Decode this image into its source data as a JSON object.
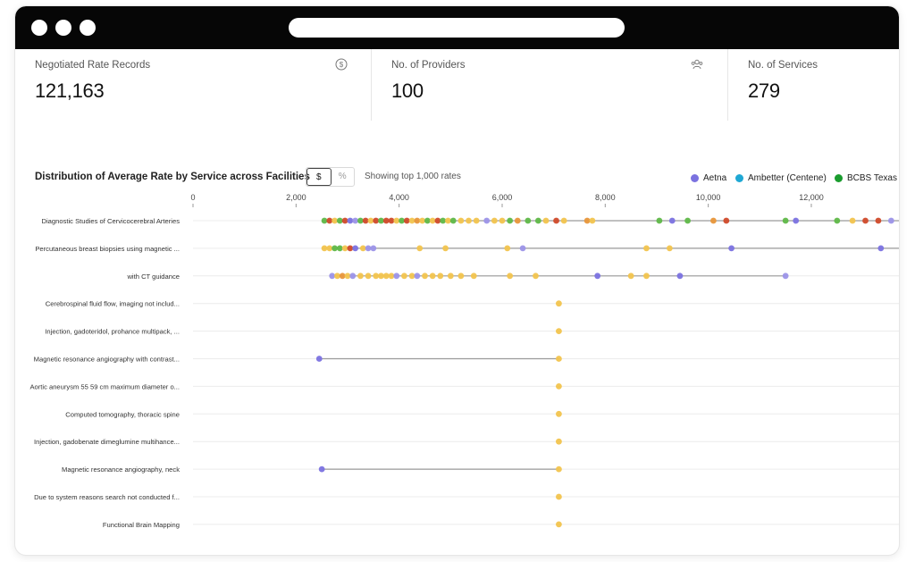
{
  "kpis": [
    {
      "label": "Negotiated Rate Records",
      "value": "121,163",
      "icon": "dollar-icon"
    },
    {
      "label": "No. of Providers",
      "value": "100",
      "icon": "users-icon"
    },
    {
      "label": "No. of Services",
      "value": "279"
    }
  ],
  "chart_header": {
    "title": "Distribution of Average Rate by Service across Facilities",
    "toggle_dollar": "$",
    "toggle_percent": "%",
    "showing": "Showing top 1,000 rates"
  },
  "legend": [
    {
      "name": "Aetna",
      "color": "#7b72e0"
    },
    {
      "name": "Ambetter (Centene)",
      "color": "#1fa8d4"
    },
    {
      "name": "BCBS Texas",
      "color": "#1a9c2e"
    }
  ],
  "colors": {
    "yellow": "#f2c44e",
    "green": "#5fb848",
    "red": "#d04a2a",
    "orange": "#e8963a",
    "purple": "#7b72e0",
    "lavender": "#9c94e8",
    "line": "#9a9a9a"
  },
  "chart_data": {
    "type": "scatter",
    "x_ticks": [
      "0",
      "2,000",
      "4,000",
      "6,000",
      "8,000",
      "10,000",
      "12,000"
    ],
    "x_tick_values": [
      0,
      2000,
      4000,
      6000,
      8000,
      10000,
      12000
    ],
    "xlim": [
      0,
      13700
    ],
    "grid": true,
    "rows": [
      {
        "label": "Diagnostic Studies of Cervicocerebral Arteries",
        "min": 2500,
        "max": 13700,
        "points": [
          {
            "x": 2550,
            "c": "green"
          },
          {
            "x": 2650,
            "c": "red"
          },
          {
            "x": 2750,
            "c": "yellow"
          },
          {
            "x": 2850,
            "c": "green"
          },
          {
            "x": 2950,
            "c": "red"
          },
          {
            "x": 3050,
            "c": "purple"
          },
          {
            "x": 3150,
            "c": "lavender"
          },
          {
            "x": 3250,
            "c": "green"
          },
          {
            "x": 3350,
            "c": "red"
          },
          {
            "x": 3450,
            "c": "yellow"
          },
          {
            "x": 3550,
            "c": "red"
          },
          {
            "x": 3650,
            "c": "green"
          },
          {
            "x": 3750,
            "c": "red"
          },
          {
            "x": 3850,
            "c": "red"
          },
          {
            "x": 3950,
            "c": "yellow"
          },
          {
            "x": 4050,
            "c": "green"
          },
          {
            "x": 4150,
            "c": "red"
          },
          {
            "x": 4250,
            "c": "yellow"
          },
          {
            "x": 4350,
            "c": "orange"
          },
          {
            "x": 4450,
            "c": "yellow"
          },
          {
            "x": 4550,
            "c": "green"
          },
          {
            "x": 4650,
            "c": "yellow"
          },
          {
            "x": 4750,
            "c": "red"
          },
          {
            "x": 4850,
            "c": "green"
          },
          {
            "x": 4950,
            "c": "yellow"
          },
          {
            "x": 5050,
            "c": "green"
          },
          {
            "x": 5200,
            "c": "yellow"
          },
          {
            "x": 5350,
            "c": "yellow"
          },
          {
            "x": 5500,
            "c": "yellow"
          },
          {
            "x": 5700,
            "c": "lavender"
          },
          {
            "x": 5850,
            "c": "yellow"
          },
          {
            "x": 6000,
            "c": "yellow"
          },
          {
            "x": 6150,
            "c": "green"
          },
          {
            "x": 6300,
            "c": "orange"
          },
          {
            "x": 6500,
            "c": "green"
          },
          {
            "x": 6700,
            "c": "green"
          },
          {
            "x": 6850,
            "c": "yellow"
          },
          {
            "x": 7050,
            "c": "red"
          },
          {
            "x": 7200,
            "c": "yellow"
          },
          {
            "x": 7650,
            "c": "orange"
          },
          {
            "x": 7750,
            "c": "yellow"
          },
          {
            "x": 9050,
            "c": "green"
          },
          {
            "x": 9300,
            "c": "purple"
          },
          {
            "x": 9600,
            "c": "green"
          },
          {
            "x": 10100,
            "c": "orange"
          },
          {
            "x": 10350,
            "c": "red"
          },
          {
            "x": 11500,
            "c": "green"
          },
          {
            "x": 11700,
            "c": "purple"
          },
          {
            "x": 12500,
            "c": "green"
          },
          {
            "x": 12800,
            "c": "yellow"
          },
          {
            "x": 13050,
            "c": "red"
          },
          {
            "x": 13300,
            "c": "red"
          },
          {
            "x": 13550,
            "c": "lavender"
          }
        ]
      },
      {
        "label": "Percutaneous breast biopsies using magnetic ...",
        "min": 2500,
        "max": 13700,
        "points": [
          {
            "x": 2550,
            "c": "yellow"
          },
          {
            "x": 2650,
            "c": "yellow"
          },
          {
            "x": 2750,
            "c": "green"
          },
          {
            "x": 2850,
            "c": "green"
          },
          {
            "x": 2950,
            "c": "yellow"
          },
          {
            "x": 3050,
            "c": "red"
          },
          {
            "x": 3150,
            "c": "purple"
          },
          {
            "x": 3300,
            "c": "yellow"
          },
          {
            "x": 3400,
            "c": "lavender"
          },
          {
            "x": 3500,
            "c": "lavender"
          },
          {
            "x": 4400,
            "c": "yellow"
          },
          {
            "x": 4900,
            "c": "yellow"
          },
          {
            "x": 6100,
            "c": "yellow"
          },
          {
            "x": 6400,
            "c": "lavender"
          },
          {
            "x": 8800,
            "c": "yellow"
          },
          {
            "x": 9250,
            "c": "yellow"
          },
          {
            "x": 10450,
            "c": "purple"
          },
          {
            "x": 13350,
            "c": "purple"
          }
        ]
      },
      {
        "label": "with CT guidance",
        "min": 2650,
        "max": 11500,
        "points": [
          {
            "x": 2700,
            "c": "lavender"
          },
          {
            "x": 2800,
            "c": "yellow"
          },
          {
            "x": 2900,
            "c": "orange"
          },
          {
            "x": 3000,
            "c": "yellow"
          },
          {
            "x": 3100,
            "c": "lavender"
          },
          {
            "x": 3250,
            "c": "yellow"
          },
          {
            "x": 3400,
            "c": "yellow"
          },
          {
            "x": 3550,
            "c": "yellow"
          },
          {
            "x": 3650,
            "c": "yellow"
          },
          {
            "x": 3750,
            "c": "yellow"
          },
          {
            "x": 3850,
            "c": "yellow"
          },
          {
            "x": 3950,
            "c": "lavender"
          },
          {
            "x": 4100,
            "c": "yellow"
          },
          {
            "x": 4250,
            "c": "yellow"
          },
          {
            "x": 4350,
            "c": "lavender"
          },
          {
            "x": 4500,
            "c": "yellow"
          },
          {
            "x": 4650,
            "c": "yellow"
          },
          {
            "x": 4800,
            "c": "yellow"
          },
          {
            "x": 5000,
            "c": "yellow"
          },
          {
            "x": 5200,
            "c": "yellow"
          },
          {
            "x": 5450,
            "c": "yellow"
          },
          {
            "x": 6150,
            "c": "yellow"
          },
          {
            "x": 6650,
            "c": "yellow"
          },
          {
            "x": 7850,
            "c": "purple"
          },
          {
            "x": 8500,
            "c": "yellow"
          },
          {
            "x": 8800,
            "c": "yellow"
          },
          {
            "x": 9450,
            "c": "purple"
          },
          {
            "x": 11500,
            "c": "lavender"
          }
        ]
      },
      {
        "label": "Cerebrospinal fluid flow, imaging not includ...",
        "min": 7100,
        "max": 7100,
        "points": [
          {
            "x": 7100,
            "c": "yellow"
          }
        ]
      },
      {
        "label": "Injection, gadoteridol, prohance multipack, ...",
        "min": 7100,
        "max": 7100,
        "points": [
          {
            "x": 7100,
            "c": "yellow"
          }
        ]
      },
      {
        "label": "Magnetic resonance angiography with contrast...",
        "min": 2450,
        "max": 7100,
        "points": [
          {
            "x": 2450,
            "c": "purple"
          },
          {
            "x": 7100,
            "c": "yellow"
          }
        ]
      },
      {
        "label": "Aortic aneurysm 55 59 cm maximum diameter o...",
        "min": 7100,
        "max": 7100,
        "points": [
          {
            "x": 7100,
            "c": "yellow"
          }
        ]
      },
      {
        "label": "Computed tomography, thoracic spine",
        "min": 7100,
        "max": 7100,
        "points": [
          {
            "x": 7100,
            "c": "yellow"
          }
        ]
      },
      {
        "label": "Injection, gadobenate dimeglumine multihance...",
        "min": 7100,
        "max": 7100,
        "points": [
          {
            "x": 7100,
            "c": "yellow"
          }
        ]
      },
      {
        "label": "Magnetic resonance angiography, neck",
        "min": 2500,
        "max": 7100,
        "points": [
          {
            "x": 2500,
            "c": "purple"
          },
          {
            "x": 7100,
            "c": "yellow"
          }
        ]
      },
      {
        "label": "Due to system reasons search not conducted f...",
        "min": 7100,
        "max": 7100,
        "points": [
          {
            "x": 7100,
            "c": "yellow"
          }
        ]
      },
      {
        "label": "Functional Brain Mapping",
        "min": 7100,
        "max": 7100,
        "points": [
          {
            "x": 7100,
            "c": "yellow"
          }
        ]
      }
    ]
  }
}
